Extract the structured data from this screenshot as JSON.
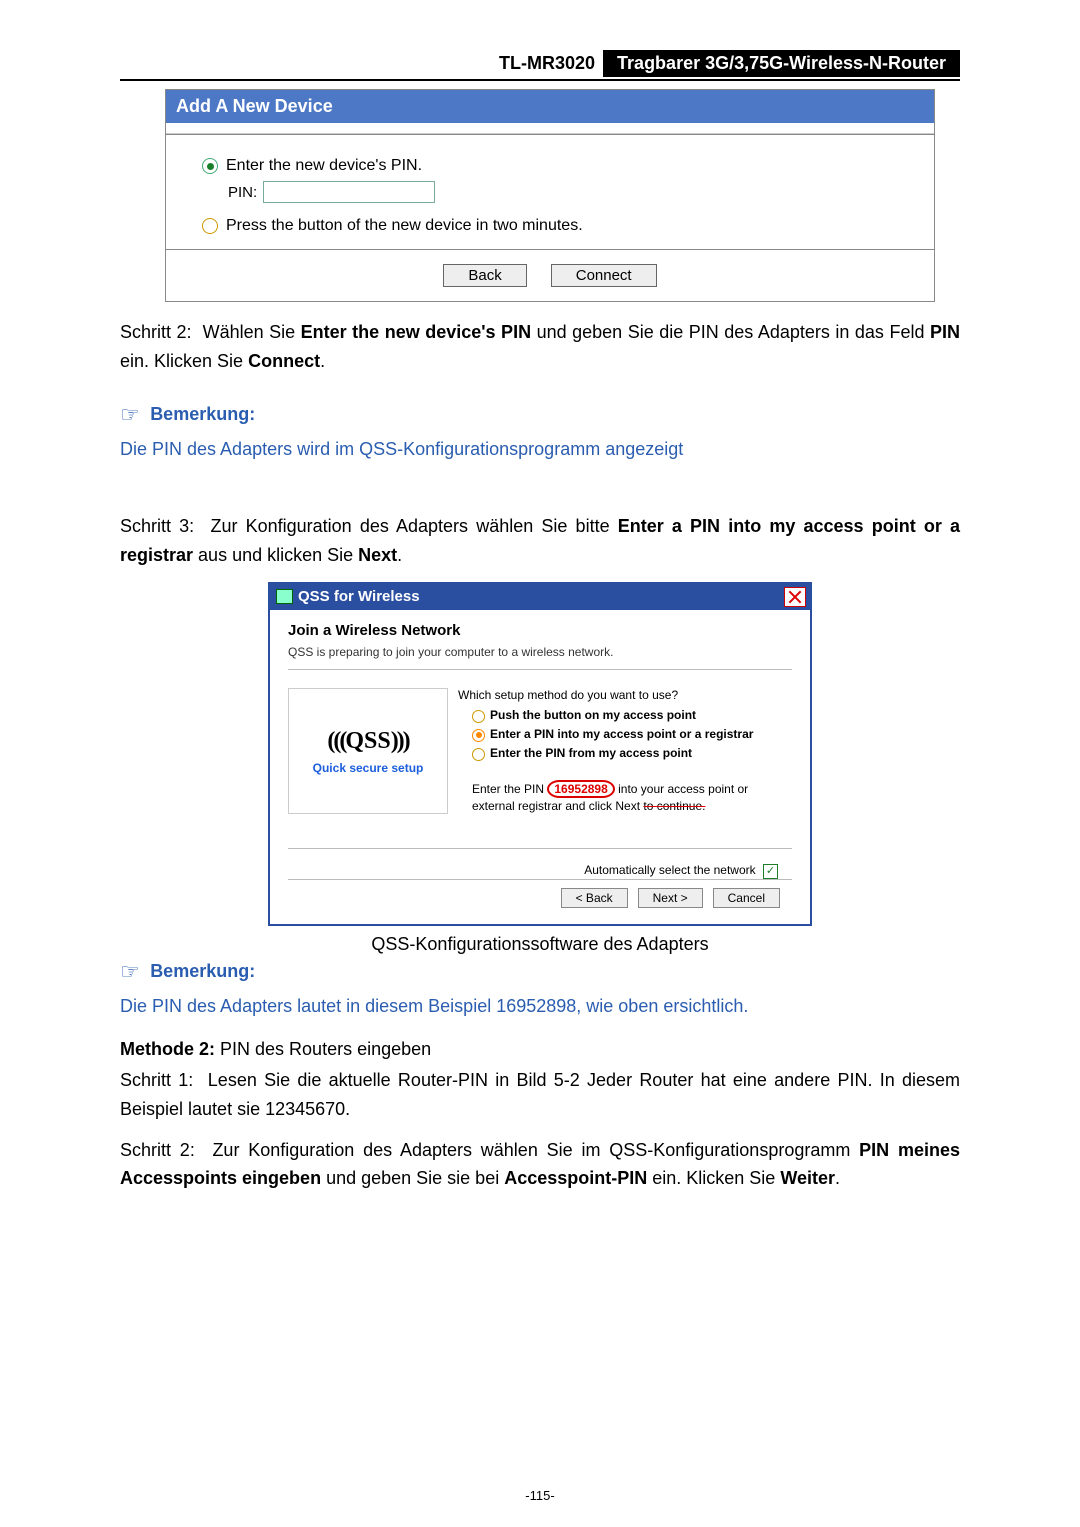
{
  "header": {
    "model": "TL-MR3020",
    "title": "Tragbarer 3G/3,75G-Wireless-N-Router"
  },
  "panel": {
    "title": "Add A New Device",
    "opt1": "Enter the new device's PIN.",
    "pin_label": "PIN:",
    "opt2": "Press the button of the new device in two minutes.",
    "back": "Back",
    "connect": "Connect"
  },
  "step2": {
    "prefix": "Schritt 2:",
    "t1": "Wählen Sie ",
    "b1": "Enter the new device's PIN",
    "t2": " und geben Sie die PIN des Adapters in das Feld ",
    "b2": "PIN",
    "t3": " ein. Klicken Sie ",
    "b3": "Connect",
    "t4": "."
  },
  "note1": {
    "title": "Bemerkung:",
    "text": "Die PIN des Adapters wird im QSS-Konfigurationsprogramm angezeigt"
  },
  "step3": {
    "prefix": "Schritt 3:",
    "t1": "Zur Konfiguration des Adapters wählen Sie bitte ",
    "b1": "Enter a PIN into my access point or a registrar",
    "t2": " aus und klicken Sie ",
    "b2": "Next",
    "t3": "."
  },
  "qss": {
    "titlebar": "QSS for Wireless",
    "h": "Join a Wireless Network",
    "sub": "QSS is preparing to join your computer to a wireless network.",
    "left_caption": "Quick secure setup",
    "method_q": "Which setup method do you want to use?",
    "opt_push": "Push the button on my access point",
    "opt_enter_pin_ap": "Enter a PIN into my access point or a registrar",
    "opt_enter_pin_from": "Enter the PIN from my access point",
    "instr_a": "Enter the PIN ",
    "instr_pin": "16952898",
    "instr_b": " into your access point or external registrar and click Next ",
    "instr_struck": "to continue.",
    "auto": "Automatically select the network",
    "back": "< Back",
    "next": "Next >",
    "cancel": "Cancel"
  },
  "caption2": "QSS-Konfigurationssoftware des Adapters",
  "note2": {
    "title": "Bemerkung:",
    "text": "Die PIN des Adapters lautet in diesem Beispiel 16952898, wie oben ersichtlich."
  },
  "method2": {
    "b": "Methode 2:",
    "t": " PIN des Routers eingeben"
  },
  "m2s1": {
    "prefix": "Schritt 1:",
    "t1": "Lesen Sie die aktuelle Router-PIN in ",
    "ref": "Bild 5-2",
    "t2": " Jeder Router hat eine andere PIN. In diesem Beispiel lautet sie 12345670."
  },
  "m2s2": {
    "prefix": "Schritt 2:",
    "t1": "Zur Konfiguration des Adapters wählen Sie im QSS-Konfigurationsprogramm ",
    "b1": "PIN meines Accesspoints eingeben",
    "t2": " und geben Sie sie bei ",
    "b2": "Accesspoint-PIN",
    "t3": " ein. Klicken Sie ",
    "b3": "Weiter",
    "t4": "."
  },
  "page_number": "-115-"
}
